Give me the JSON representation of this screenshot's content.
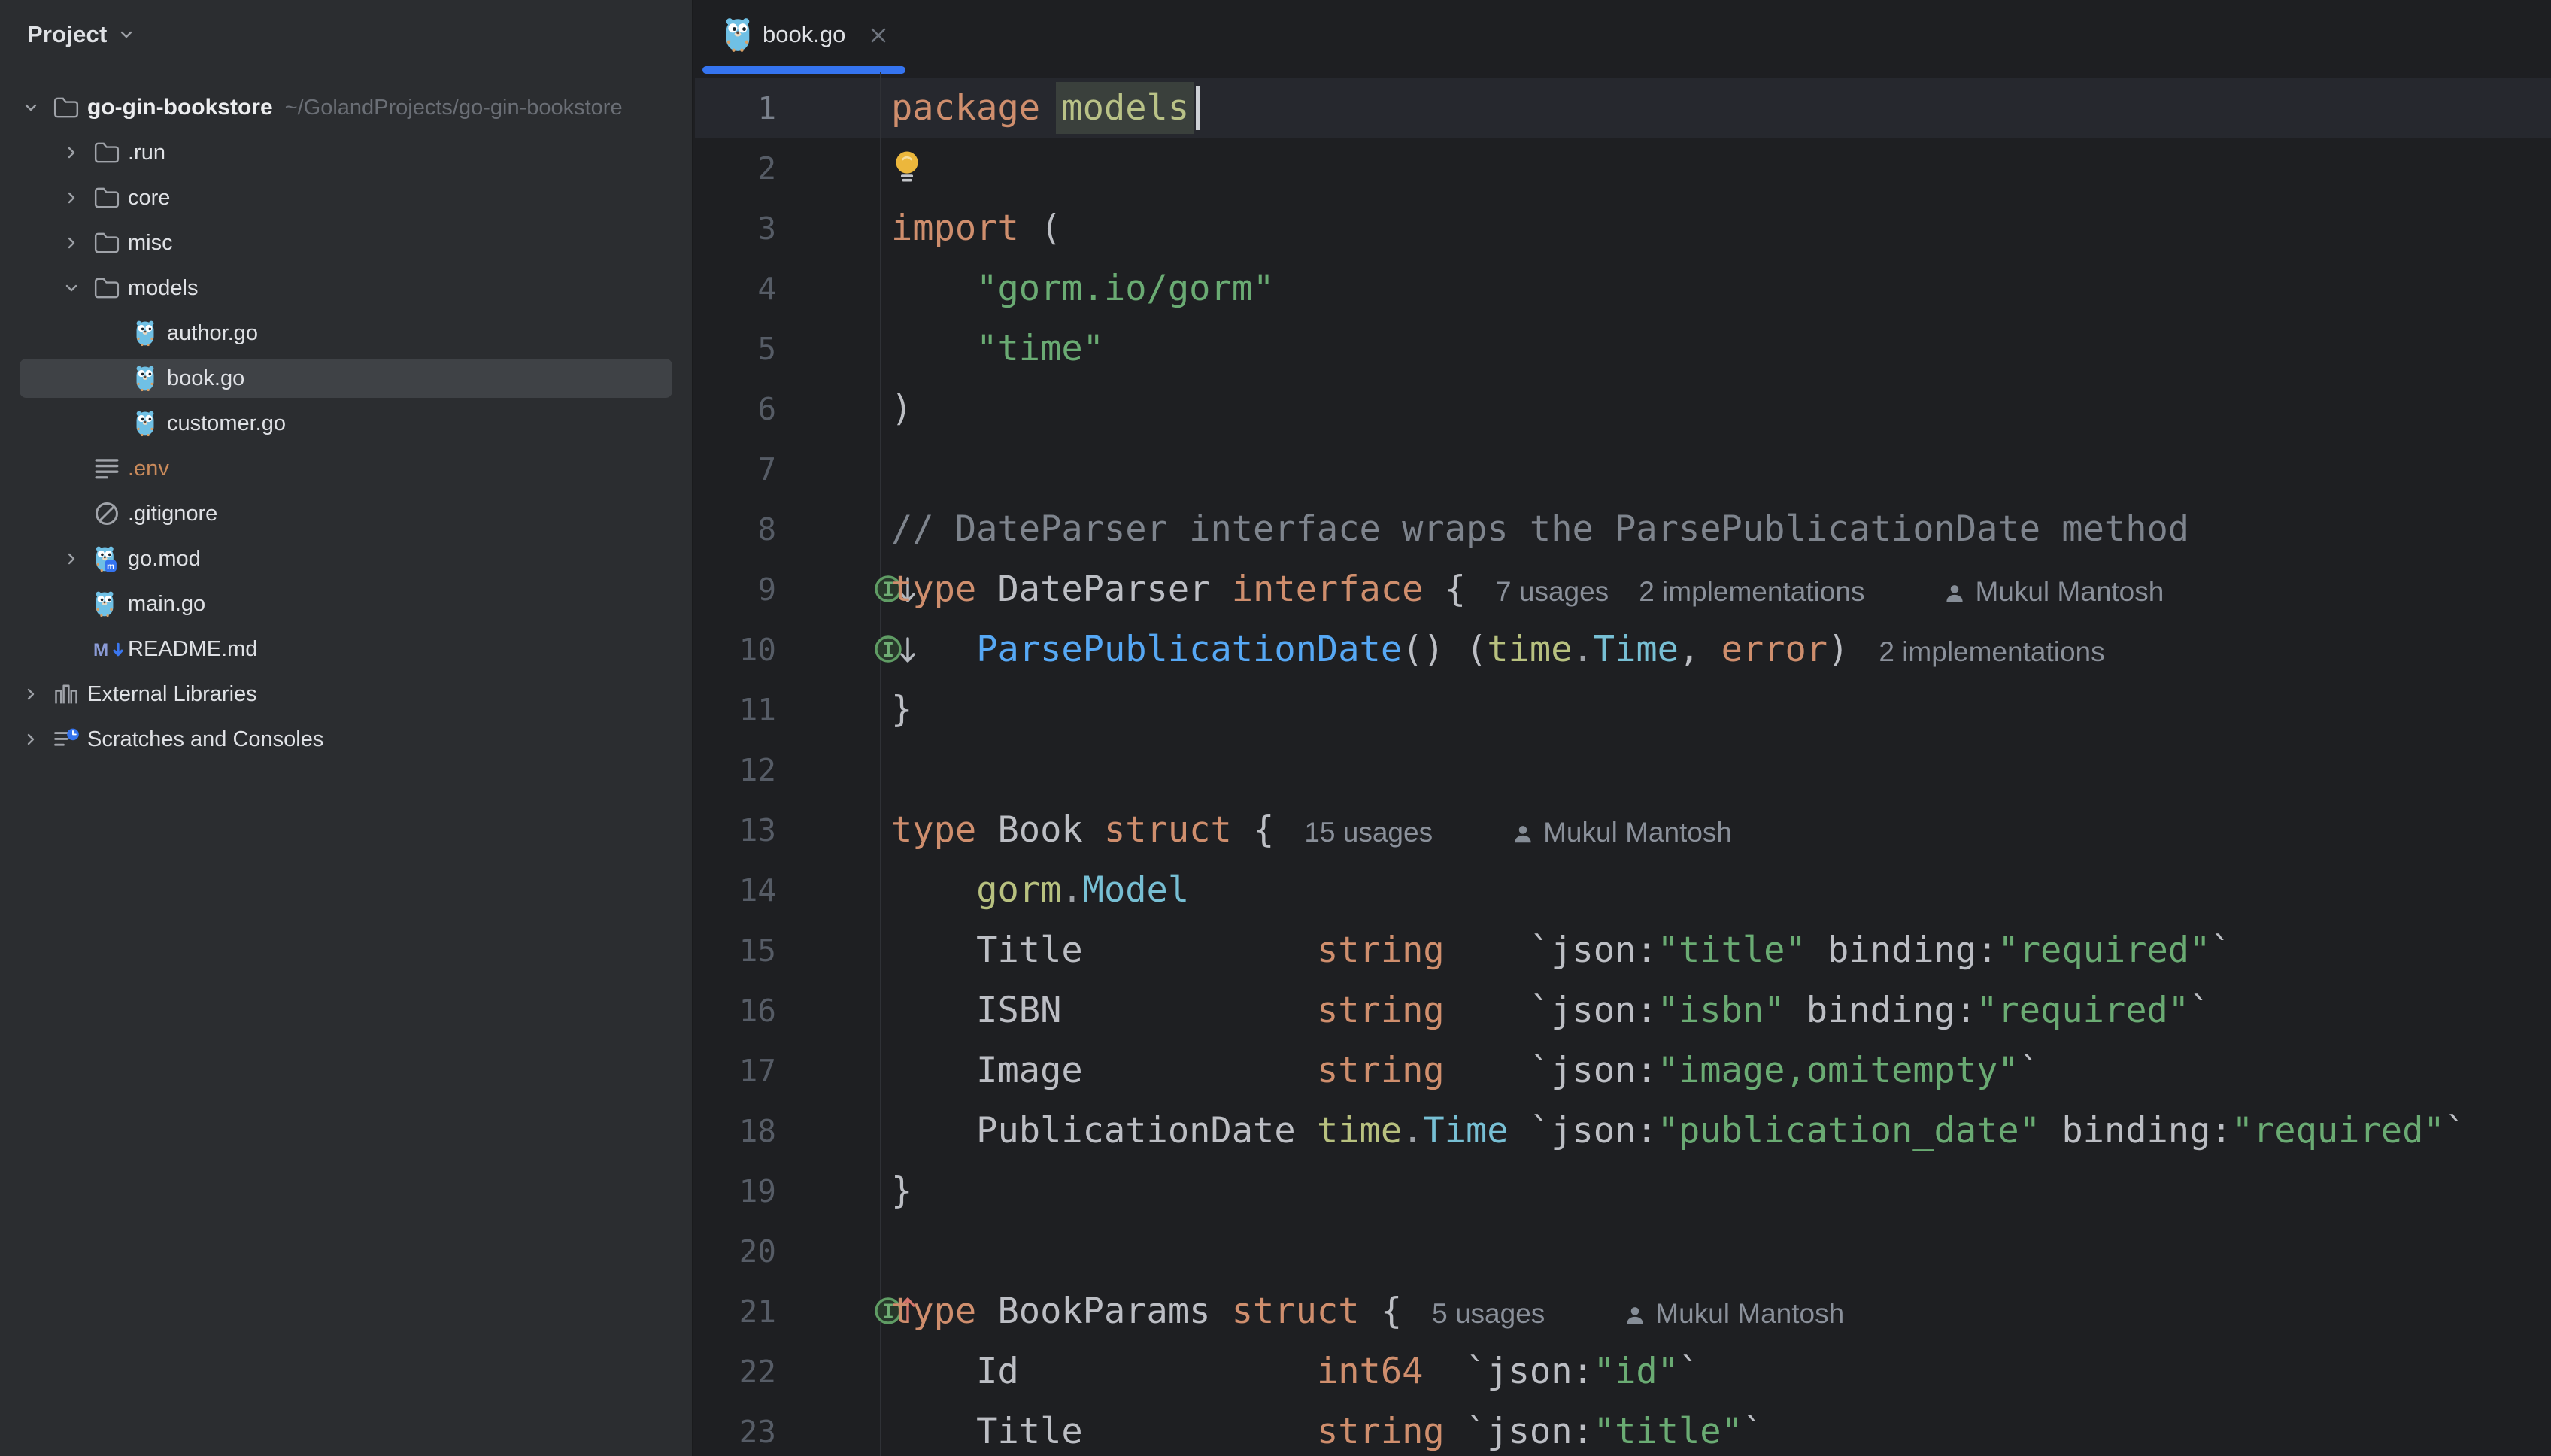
{
  "colors": {
    "accent_blue": "#3574F0",
    "panel_bg": "#2B2D30",
    "editor_bg": "#1E1F22",
    "caret_line_bg": "#26282E",
    "selection_bg": "#3A403C",
    "keyword": "#CF8E6D",
    "string": "#6AAB73",
    "function": "#56A8F5",
    "type_name": "#77BFD4",
    "package_name": "#B8C17F",
    "comment": "#7E848D"
  },
  "project_panel": {
    "title": "Project",
    "items": [
      {
        "label": "go-gin-bookstore",
        "path": "~/GolandProjects/go-gin-bookstore",
        "icon": "folder",
        "depth": 0,
        "chevron": "expanded",
        "root": true
      },
      {
        "label": ".run",
        "icon": "folder",
        "depth": 1,
        "chevron": "collapsed"
      },
      {
        "label": "core",
        "icon": "folder",
        "depth": 1,
        "chevron": "collapsed"
      },
      {
        "label": "misc",
        "icon": "folder",
        "depth": 1,
        "chevron": "collapsed"
      },
      {
        "label": "models",
        "icon": "folder",
        "depth": 1,
        "chevron": "expanded"
      },
      {
        "label": "author.go",
        "icon": "go",
        "depth": 2
      },
      {
        "label": "book.go",
        "icon": "go",
        "depth": 2,
        "selected": true
      },
      {
        "label": "customer.go",
        "icon": "go",
        "depth": 2
      },
      {
        "label": ".env",
        "icon": "env",
        "depth": 1,
        "accent": true
      },
      {
        "label": ".gitignore",
        "icon": "gitignore",
        "depth": 1
      },
      {
        "label": "go.mod",
        "icon": "gomod",
        "depth": 1,
        "chevron": "collapsed"
      },
      {
        "label": "main.go",
        "icon": "go",
        "depth": 1
      },
      {
        "label": "README.md",
        "icon": "markdown",
        "depth": 1
      },
      {
        "label": "External Libraries",
        "icon": "libraries",
        "depth": 0,
        "chevron": "collapsed"
      },
      {
        "label": "Scratches and Consoles",
        "icon": "scratches",
        "depth": 0,
        "chevron": "collapsed"
      }
    ]
  },
  "editor": {
    "tab": {
      "label": "book.go"
    },
    "lines": [
      {
        "num": 1,
        "tokens": [
          {
            "t": "package",
            "c": "kw"
          },
          {
            "t": " ",
            "c": "plain"
          },
          {
            "t": "models",
            "c": "pkgsel"
          },
          {
            "c": "caret"
          }
        ]
      },
      {
        "num": 2,
        "tokens": [
          {
            "c": "bulb"
          }
        ]
      },
      {
        "num": 3,
        "tokens": [
          {
            "t": "import",
            "c": "kw"
          },
          {
            "t": " (",
            "c": "plain"
          }
        ]
      },
      {
        "num": 4,
        "tokens": [
          {
            "t": "    \"gorm.io/gorm\"",
            "c": "str"
          }
        ]
      },
      {
        "num": 5,
        "tokens": [
          {
            "t": "    \"time\"",
            "c": "str"
          }
        ]
      },
      {
        "num": 6,
        "tokens": [
          {
            "t": ")",
            "c": "plain"
          }
        ]
      },
      {
        "num": 7,
        "tokens": []
      },
      {
        "num": 8,
        "tokens": [
          {
            "t": "// DateParser interface wraps the ParsePublicationDate method",
            "c": "com"
          }
        ]
      },
      {
        "num": 9,
        "gutter_icon": "impl-down",
        "tokens": [
          {
            "t": "type",
            "c": "kw"
          },
          {
            "t": " DateParser ",
            "c": "plain"
          },
          {
            "t": "interface",
            "c": "kw"
          },
          {
            "t": " {",
            "c": "plain"
          },
          {
            "t": "7 usages",
            "c": "hint"
          },
          {
            "t": "2 implementations",
            "c": "hint"
          },
          {
            "t": "Mukul Mantosh",
            "c": "author"
          }
        ]
      },
      {
        "num": 10,
        "gutter_icon": "impl-down",
        "tokens": [
          {
            "t": "    ",
            "c": "plain"
          },
          {
            "t": "ParsePublicationDate",
            "c": "fn"
          },
          {
            "t": "() (",
            "c": "plain"
          },
          {
            "t": "time",
            "c": "pkg"
          },
          {
            "t": ".",
            "c": "dot"
          },
          {
            "t": "Time",
            "c": "typ"
          },
          {
            "t": ", ",
            "c": "plain"
          },
          {
            "t": "error",
            "c": "kw"
          },
          {
            "t": ")",
            "c": "plain"
          },
          {
            "t": "2 implementations",
            "c": "hint"
          }
        ]
      },
      {
        "num": 11,
        "tokens": [
          {
            "t": "}",
            "c": "plain"
          }
        ]
      },
      {
        "num": 12,
        "tokens": []
      },
      {
        "num": 13,
        "tokens": [
          {
            "t": "type",
            "c": "kw"
          },
          {
            "t": " Book ",
            "c": "plain"
          },
          {
            "t": "struct",
            "c": "kw"
          },
          {
            "t": " {",
            "c": "plain"
          },
          {
            "t": "15 usages",
            "c": "hint"
          },
          {
            "t": "Mukul Mantosh",
            "c": "author"
          }
        ]
      },
      {
        "num": 14,
        "tokens": [
          {
            "t": "    ",
            "c": "plain"
          },
          {
            "t": "gorm",
            "c": "pkg"
          },
          {
            "t": ".",
            "c": "dot"
          },
          {
            "t": "Model",
            "c": "typ"
          }
        ]
      },
      {
        "num": 15,
        "tokens": [
          {
            "t": "    Title           ",
            "c": "plain"
          },
          {
            "t": "string",
            "c": "kw"
          },
          {
            "t": "    `json:",
            "c": "plain"
          },
          {
            "t": "\"title\"",
            "c": "str"
          },
          {
            "t": " binding:",
            "c": "plain"
          },
          {
            "t": "\"required\"",
            "c": "str"
          },
          {
            "t": "`",
            "c": "plain"
          }
        ]
      },
      {
        "num": 16,
        "tokens": [
          {
            "t": "    ISBN            ",
            "c": "plain"
          },
          {
            "t": "string",
            "c": "kw"
          },
          {
            "t": "    `json:",
            "c": "plain"
          },
          {
            "t": "\"isbn\"",
            "c": "str"
          },
          {
            "t": " binding:",
            "c": "plain"
          },
          {
            "t": "\"required\"",
            "c": "str"
          },
          {
            "t": "`",
            "c": "plain"
          }
        ]
      },
      {
        "num": 17,
        "tokens": [
          {
            "t": "    Image           ",
            "c": "plain"
          },
          {
            "t": "string",
            "c": "kw"
          },
          {
            "t": "    `json:",
            "c": "plain"
          },
          {
            "t": "\"image,omitempty\"",
            "c": "str"
          },
          {
            "t": "`",
            "c": "plain"
          }
        ]
      },
      {
        "num": 18,
        "tokens": [
          {
            "t": "    PublicationDate ",
            "c": "plain"
          },
          {
            "t": "time",
            "c": "pkg"
          },
          {
            "t": ".",
            "c": "dot"
          },
          {
            "t": "Time",
            "c": "typ"
          },
          {
            "t": " `json:",
            "c": "plain"
          },
          {
            "t": "\"publication_date\"",
            "c": "str"
          },
          {
            "t": " binding:",
            "c": "plain"
          },
          {
            "t": "\"required\"",
            "c": "str"
          },
          {
            "t": "`",
            "c": "plain"
          }
        ]
      },
      {
        "num": 19,
        "tokens": [
          {
            "t": "}",
            "c": "plain"
          }
        ]
      },
      {
        "num": 20,
        "tokens": []
      },
      {
        "num": 21,
        "gutter_icon": "impl-up",
        "tokens": [
          {
            "t": "type",
            "c": "kw"
          },
          {
            "t": " BookParams ",
            "c": "plain"
          },
          {
            "t": "struct",
            "c": "kw"
          },
          {
            "t": " {",
            "c": "plain"
          },
          {
            "t": "5 usages",
            "c": "hint"
          },
          {
            "t": "Mukul Mantosh",
            "c": "author"
          }
        ]
      },
      {
        "num": 22,
        "tokens": [
          {
            "t": "    Id              ",
            "c": "plain"
          },
          {
            "t": "int64",
            "c": "kw"
          },
          {
            "t": "  `json:",
            "c": "plain"
          },
          {
            "t": "\"id\"",
            "c": "str"
          },
          {
            "t": "`",
            "c": "plain"
          }
        ]
      },
      {
        "num": 23,
        "tokens": [
          {
            "t": "    Title           ",
            "c": "plain"
          },
          {
            "t": "string",
            "c": "kw"
          },
          {
            "t": " `json:",
            "c": "plain"
          },
          {
            "t": "\"title\"",
            "c": "str"
          },
          {
            "t": "`",
            "c": "plain"
          }
        ]
      }
    ]
  }
}
